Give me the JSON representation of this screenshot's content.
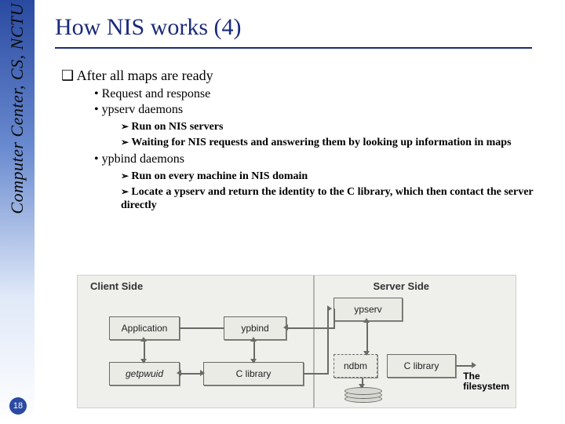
{
  "sidebar": {
    "org": "Computer Center, CS, NCTU"
  },
  "page_number": "18",
  "title": "How NIS works (4)",
  "section": {
    "marker": "❑",
    "heading": "After all maps are ready",
    "items": [
      {
        "label": "Request and response"
      },
      {
        "label": "ypserv daemons",
        "sub": [
          "Run on NIS servers",
          "Waiting for NIS requests and answering them by looking up information in maps"
        ]
      },
      {
        "label": "ypbind daemons",
        "sub": [
          "Run on every machine in NIS domain",
          "Locate a ypserv and return the identity to the C library, which then contact the server directly"
        ]
      }
    ]
  },
  "diagram": {
    "client_side_label": "Client Side",
    "server_side_label": "Server Side",
    "boxes": {
      "application": "Application",
      "getpwuid": "getpwuid",
      "ypbind": "ypbind",
      "c_library_client": "C library",
      "ypserv": "ypserv",
      "ndbm": "ndbm",
      "c_library_server": "C library"
    },
    "filesystem_label_1": "The",
    "filesystem_label_2": "filesystem"
  }
}
